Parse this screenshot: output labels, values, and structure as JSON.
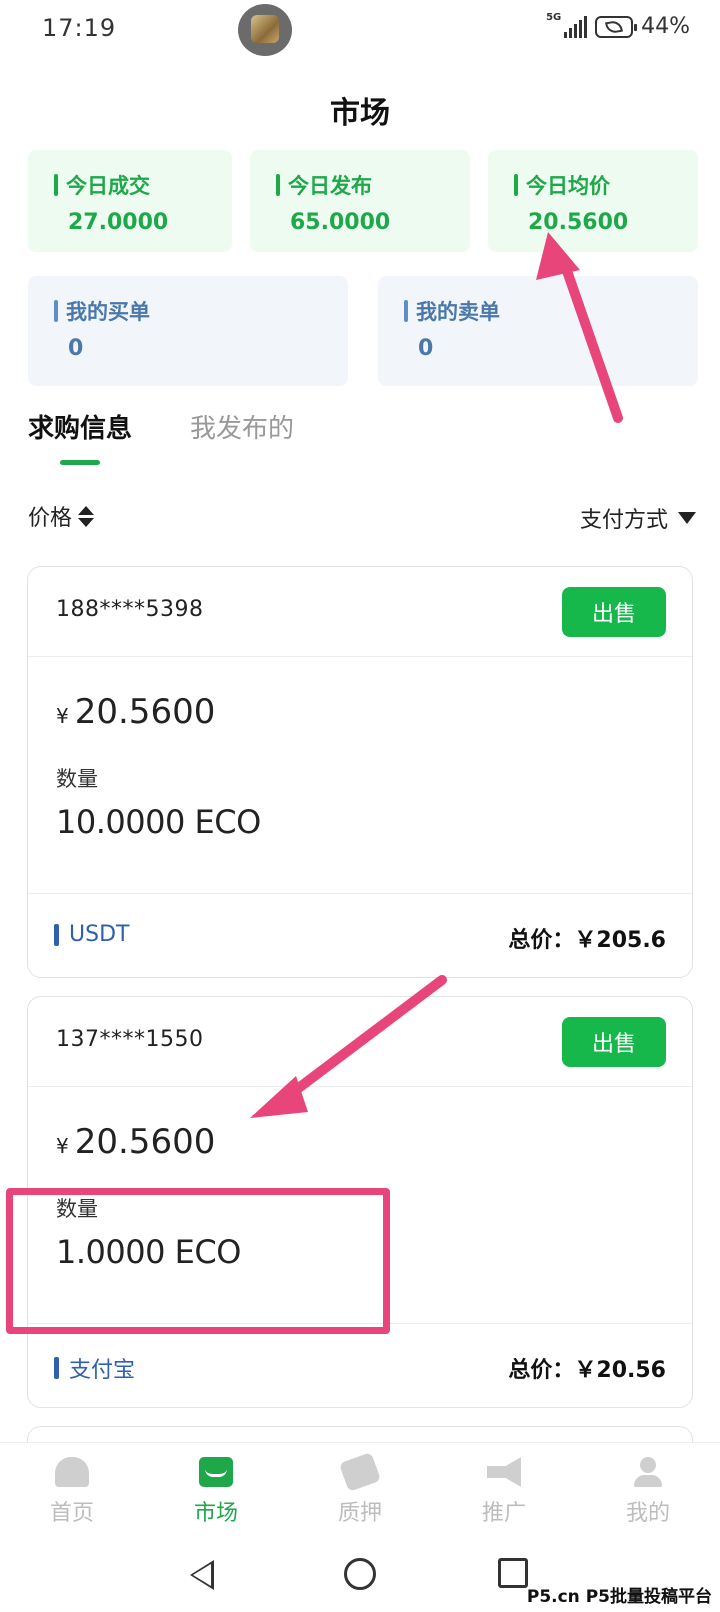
{
  "status_bar": {
    "time": "17:19",
    "network": "5G",
    "battery": "44%"
  },
  "header": {
    "title": "市场"
  },
  "stats": {
    "today_volume": {
      "label": "今日成交",
      "value": "27.0000"
    },
    "today_posted": {
      "label": "今日发布",
      "value": "65.0000"
    },
    "today_avg_price": {
      "label": "今日均价",
      "value": "20.5600"
    },
    "my_buy_orders": {
      "label": "我的买单",
      "value": "0"
    },
    "my_sell_orders": {
      "label": "我的卖单",
      "value": "0"
    }
  },
  "tabs": [
    {
      "label": "求购信息",
      "active": true
    },
    {
      "label": "我发布的",
      "active": false
    }
  ],
  "filters": {
    "price_label": "价格",
    "payment_label": "支付方式"
  },
  "orders": [
    {
      "user": "188****5398",
      "action": "出售",
      "currency_symbol": "¥",
      "price": "20.5600",
      "qty_label": "数量",
      "qty": "10.0000 ECO",
      "method": "USDT",
      "total": "总价：￥205.6"
    },
    {
      "user": "137****1550",
      "action": "出售",
      "currency_symbol": "¥",
      "price": "20.5600",
      "qty_label": "数量",
      "qty": "1.0000 ECO",
      "method": "支付宝",
      "total": "总价：￥20.56"
    }
  ],
  "bottom_nav": [
    {
      "label": "首页",
      "icon": "home-icon",
      "active": false
    },
    {
      "label": "市场",
      "icon": "market-icon",
      "active": true
    },
    {
      "label": "质押",
      "icon": "handshake-icon",
      "active": false
    },
    {
      "label": "推广",
      "icon": "megaphone-icon",
      "active": false
    },
    {
      "label": "我的",
      "icon": "user-icon",
      "active": false
    }
  ],
  "watermark": "P5.cn P5批量投稿平台",
  "colors": {
    "accent": "#1fa84a",
    "button": "#16b84c",
    "annotation": "#e8467a",
    "method": "#2f5fb0"
  }
}
